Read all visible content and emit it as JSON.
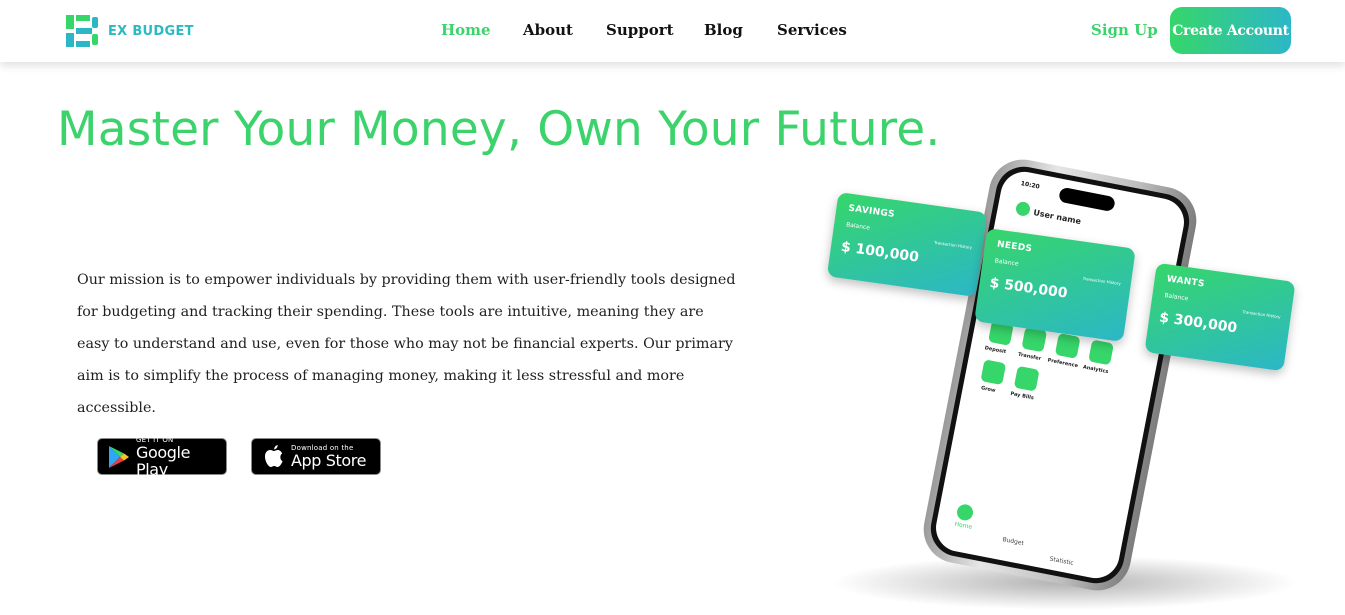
{
  "brand": {
    "name": "EX BUDGET",
    "green": "#3dd36c",
    "teal": "#2cb7c7"
  },
  "nav": {
    "items": [
      "Home",
      "About",
      "Support",
      "Blog",
      "Services"
    ],
    "active": "Home"
  },
  "auth": {
    "signup": "Sign Up",
    "create_account": "Create Account"
  },
  "hero": {
    "title": "Master Your Money, Own Your Future.",
    "mission": "Our mission is to empower individuals by providing them with user-friendly tools designed for budgeting and tracking their spending. These tools are intuitive, meaning they are easy to understand and use, even for those who may not be financial experts. Our primary aim is to simplify the process of managing money, making it less stressful and more accessible."
  },
  "stores": {
    "google": {
      "small": "GET IT ON",
      "big": "Google Play",
      "icon": "google-play-icon"
    },
    "apple": {
      "small": "Download on the",
      "big": "App Store",
      "icon": "apple-icon"
    }
  },
  "phone": {
    "time": "10:20",
    "user": "User name",
    "actions": [
      "Deposit",
      "Transfer",
      "Preference",
      "Analytics",
      "Grow",
      "Pay Bills"
    ],
    "tabs": [
      "Home",
      "Budget",
      "Statistic"
    ]
  },
  "cards": {
    "savings": {
      "title": "SAVINGS",
      "balance_label": "Balance",
      "amount": "$ 100,000",
      "history": "Transaction History"
    },
    "needs": {
      "title": "NEEDS",
      "balance_label": "Balance",
      "amount": "$ 500,000",
      "history": "Transaction History"
    },
    "wants": {
      "title": "WANTS",
      "balance_label": "Balance",
      "amount": "$ 300,000",
      "history": "Transaction History"
    }
  }
}
